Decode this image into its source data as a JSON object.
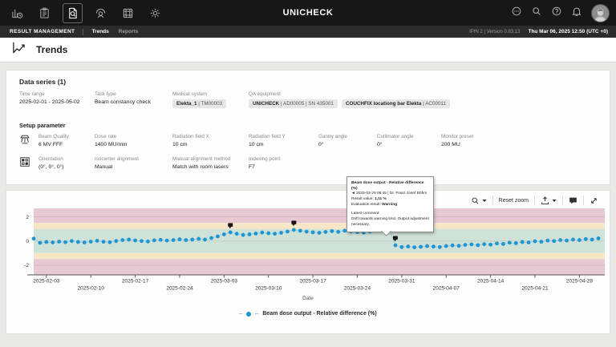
{
  "topbar": {
    "brand": "UNICHECK",
    "app_icons": [
      "statistics-icon",
      "worklist-icon",
      "results-icon",
      "patient-icon",
      "phantom-icon",
      "settings-icon"
    ],
    "active_app_icon": "results-icon",
    "right_icons": [
      "feedback-icon",
      "search-icon",
      "help-icon",
      "notifications-icon",
      "user-avatar"
    ]
  },
  "navbar": {
    "section": "RESULT MANAGEMENT",
    "tabs": [
      {
        "label": "Trends",
        "active": true
      },
      {
        "label": "Reports",
        "active": false
      }
    ],
    "instance_version": "IPIN 2 | Version 0.83.13",
    "datetime": "Thu Mar 06, 2025 12:50 (UTC +0)"
  },
  "page": {
    "title": "Trends"
  },
  "data_series": {
    "title": "Data series (1)",
    "info_fields": [
      {
        "label": "Time range",
        "text": "2025-02-01 - 2025-05-02"
      },
      {
        "label": "Task type",
        "text": "Beam constancy check"
      },
      {
        "label": "Medical system",
        "chips": [
          {
            "strong": "Elekta_1",
            "detail": "TM00003"
          }
        ]
      },
      {
        "label": "QA equipment",
        "chips": [
          {
            "strong": "UNICHECK",
            "detail": "AD00005 | SN 435001"
          },
          {
            "strong": "COUCHFIX locationg bar Elekta",
            "detail": "AC00011"
          }
        ]
      }
    ],
    "setup_title": "Setup parameter",
    "setup_rows": [
      {
        "icon": "beam-parameters-icon",
        "fields": [
          {
            "label": "Beam Quality",
            "text": "6 MV FFF"
          },
          {
            "label": "Dose rate",
            "text": "1400 MU/min"
          },
          {
            "label": "Radiation field X",
            "text": "10 cm"
          },
          {
            "label": "Radiation field Y",
            "text": "10 cm"
          },
          {
            "label": "Gantry angle",
            "text": "0°"
          },
          {
            "label": "Collimator angle",
            "text": "0°"
          },
          {
            "label": "Monitor preset",
            "text": "200 MU"
          }
        ]
      },
      {
        "icon": "orientation-icon",
        "fields": [
          {
            "label": "Orientation",
            "text": "(0°, 0°, 0°)"
          },
          {
            "label": "Isocenter alignment",
            "text": "Manual"
          },
          {
            "label": "Manual alignment method",
            "text": "Match with room lasers"
          },
          {
            "label": "Indexing point",
            "text": "F7"
          }
        ]
      }
    ]
  },
  "chart_toolbar": {
    "reset_zoom_label": "Reset zoom"
  },
  "tooltip": {
    "title": "Beam dose output - Relative difference (%)",
    "timestamp": "◄ 2025-03-29 06:45 | Dr. Franz Josef Böhm",
    "result_label": "Result value: ",
    "result_value": "1,11 %",
    "eval_label": "Evaluation result: ",
    "eval_value": "Warning",
    "comment_label": "Latest comment:",
    "comment": "Drift towards warning limit. Output adjustment necessary."
  },
  "chart_data": {
    "type": "line",
    "xlabel": "Date",
    "legend": "Beam dose output - Relative difference (%)",
    "legend_position": "bottom-center",
    "grid": "subtle horizontal lines at y ticks",
    "xlim": [
      "2025-02-01",
      "2025-05-02"
    ],
    "ylim": [
      -2.8,
      2.7
    ],
    "y_ticks": [
      2,
      0,
      -2
    ],
    "x_ticks": [
      "2025-02-03",
      "2025-02-10",
      "2025-02-17",
      "2025-02-24",
      "2025-03-03",
      "2025-03-10",
      "2025-03-17",
      "2025-03-24",
      "2025-03-31",
      "2025-04-07",
      "2025-04-14",
      "2025-04-21",
      "2025-04-28"
    ],
    "bands": [
      {
        "from": 1.5,
        "to": 2.7,
        "color": "#e6c9d3",
        "meaning": "action zone high"
      },
      {
        "from": 1.0,
        "to": 1.5,
        "color": "#f7e5c6",
        "meaning": "warning zone high"
      },
      {
        "from": -1.0,
        "to": 1.0,
        "color": "#cfe2d8",
        "meaning": "tolerance zone"
      },
      {
        "from": -1.5,
        "to": -1.0,
        "color": "#f7e5c6",
        "meaning": "warning zone low"
      },
      {
        "from": -2.8,
        "to": -1.5,
        "color": "#e6c9d3",
        "meaning": "action zone low"
      }
    ],
    "series": [
      {
        "name": "Beam dose output - Relative difference (%)",
        "color": "#1e96d2",
        "start_date": "2025-02-01",
        "interval_days": 1,
        "values": [
          0.2,
          -0.15,
          -0.08,
          -0.12,
          -0.05,
          -0.1,
          0,
          -0.08,
          -0.12,
          -0.05,
          0.02,
          -0.06,
          -0.1,
          0,
          0.08,
          0.12,
          0.05,
          0,
          -0.04,
          0.06,
          0.1,
          0.04,
          0.08,
          0.14,
          0.08,
          0.12,
          0.18,
          0.12,
          0.25,
          0.38,
          0.55,
          0.72,
          0.6,
          0.5,
          0.55,
          0.62,
          0.7,
          0.64,
          0.6,
          0.68,
          0.78,
          0.92,
          0.85,
          0.78,
          0.72,
          0.68,
          0.75,
          0.82,
          0.76,
          0.85,
          0.8,
          0.74,
          0.7,
          0.78,
          0.88,
          1.0,
          1.11,
          -0.35,
          -0.5,
          -0.45,
          -0.52,
          -0.48,
          -0.42,
          -0.46,
          -0.5,
          -0.42,
          -0.36,
          -0.4,
          -0.32,
          -0.28,
          -0.34,
          -0.26,
          -0.3,
          -0.2,
          -0.24,
          -0.14,
          -0.18,
          -0.08,
          -0.12,
          -0.02,
          -0.06,
          0.04,
          0,
          0.08,
          0.04,
          0.12,
          0.08,
          0.16,
          0.12,
          0.22
        ]
      }
    ],
    "comment_markers": [
      "2025-03-04",
      "2025-03-14",
      "2025-03-30"
    ],
    "highlight_point": {
      "date": "2025-03-29",
      "value": 1.11
    }
  }
}
